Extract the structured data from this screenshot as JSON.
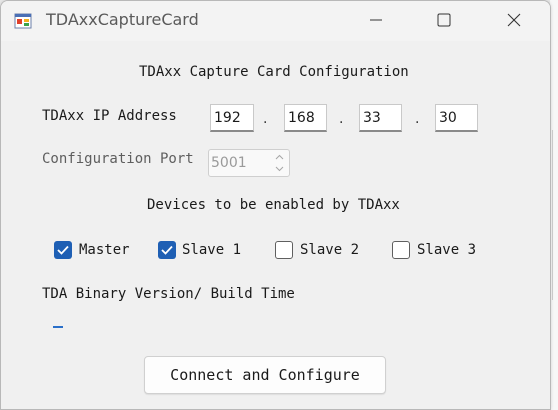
{
  "window": {
    "title": "TDAxxCaptureCard"
  },
  "header": {
    "title": "TDAxx Capture Card Configuration"
  },
  "ip": {
    "label": "TDAxx IP Address",
    "octets": [
      "192",
      "168",
      "33",
      "30"
    ],
    "separator": "."
  },
  "port": {
    "label": "Configuration Port",
    "value": "5001"
  },
  "devices": {
    "heading": "Devices to be enabled by TDAxx",
    "items": [
      {
        "label": "Master",
        "checked": true
      },
      {
        "label": "Slave 1",
        "checked": true
      },
      {
        "label": "Slave 2",
        "checked": false
      },
      {
        "label": "Slave 3",
        "checked": false
      }
    ]
  },
  "build": {
    "label": "TDA Binary Version/ Build Time",
    "value": ""
  },
  "actions": {
    "connect_label": "Connect and Configure"
  },
  "colors": {
    "accent": "#1e5fb4",
    "window_bg": "#f0f0f0"
  },
  "icons": {
    "app": "app-window-icon",
    "minimize": "minimize-icon",
    "maximize": "maximize-icon",
    "close": "close-icon"
  }
}
